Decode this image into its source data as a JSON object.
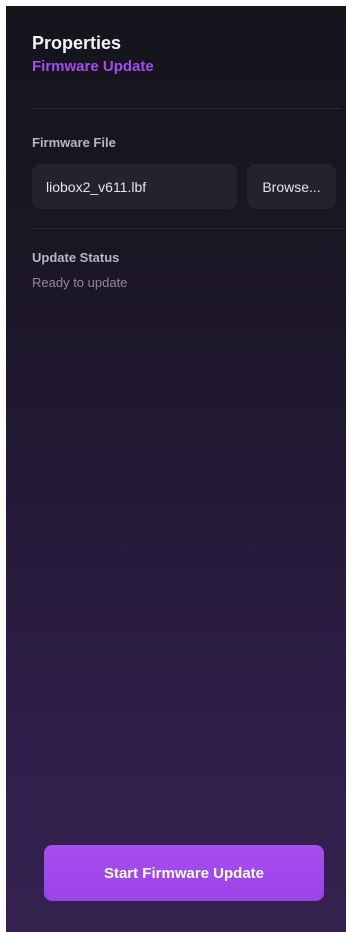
{
  "header": {
    "title": "Properties",
    "subtitle": "Firmware Update"
  },
  "firmware_file": {
    "label": "Firmware File",
    "value": "liobox2_v611.lbf",
    "browse_label": "Browse..."
  },
  "update_status": {
    "label": "Update Status",
    "text": "Ready to update"
  },
  "actions": {
    "start_label": "Start Firmware Update"
  },
  "colors": {
    "accent": "#a44cf0",
    "panel_top": "#15141b",
    "panel_bottom": "#34214f",
    "field_bg": "#25222e"
  }
}
